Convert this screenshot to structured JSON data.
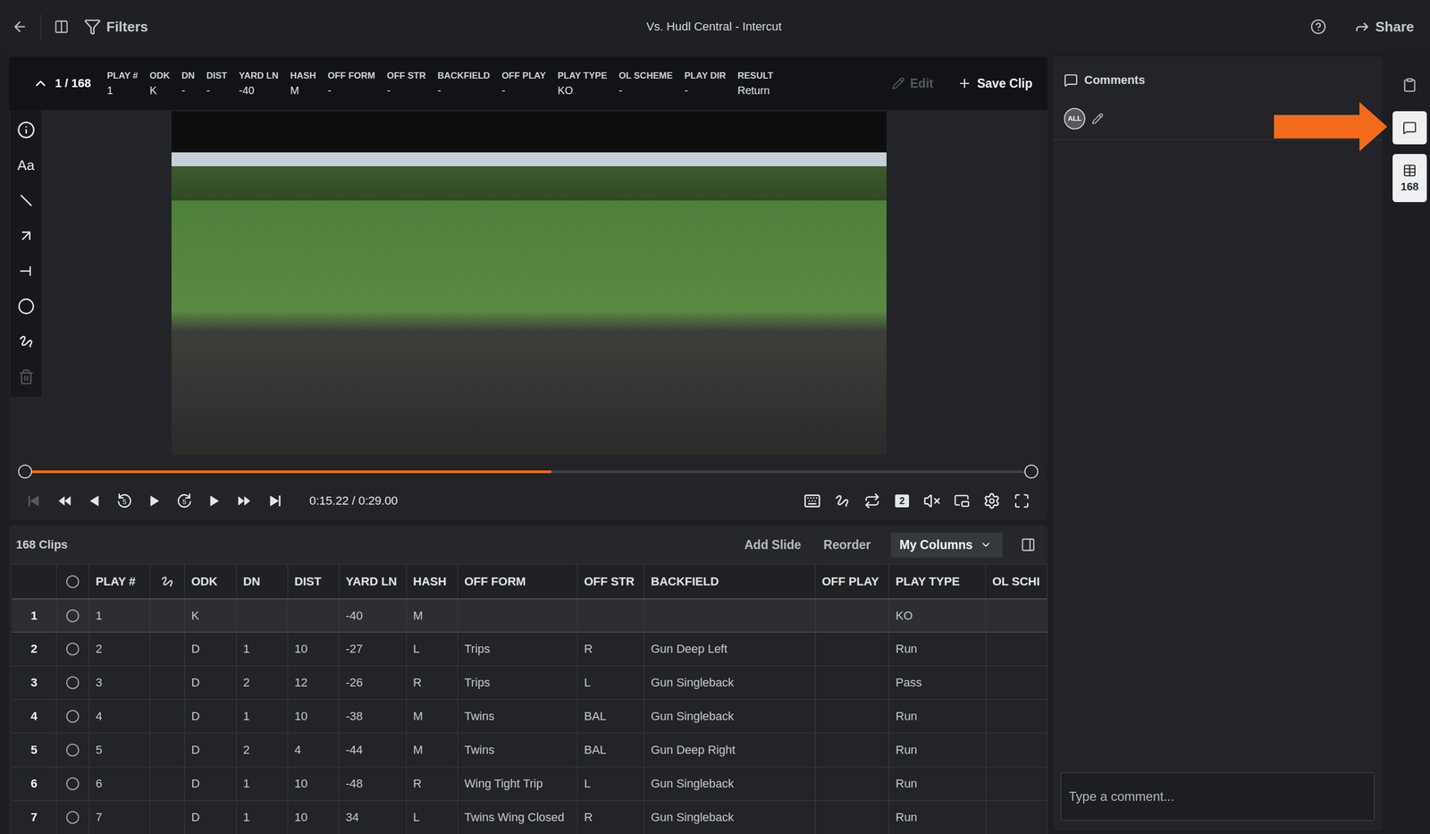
{
  "window": {
    "title": "Vs. Hudl Central - Intercut"
  },
  "topbar": {
    "filters": "Filters",
    "share": "Share"
  },
  "clip_header": {
    "position": "1 / 168",
    "fields": [
      {
        "label": "PLAY #",
        "value": "1"
      },
      {
        "label": "ODK",
        "value": "K"
      },
      {
        "label": "DN",
        "value": "-"
      },
      {
        "label": "DIST",
        "value": "-"
      },
      {
        "label": "YARD LN",
        "value": "-40"
      },
      {
        "label": "HASH",
        "value": "M"
      },
      {
        "label": "OFF FORM",
        "value": "-"
      },
      {
        "label": "OFF STR",
        "value": "-"
      },
      {
        "label": "BACKFIELD",
        "value": "-"
      },
      {
        "label": "OFF PLAY",
        "value": "-"
      },
      {
        "label": "PLAY TYPE",
        "value": "KO"
      },
      {
        "label": "OL SCHEME",
        "value": "-"
      },
      {
        "label": "PLAY DIR",
        "value": "-"
      },
      {
        "label": "RESULT",
        "value": "Return"
      }
    ],
    "edit": {
      "label": "Edit",
      "disabled": true
    },
    "save": "Save Clip"
  },
  "tools": [
    {
      "kind": "info",
      "disabled": false
    },
    {
      "kind": "text",
      "label": "Aa",
      "disabled": false
    },
    {
      "kind": "line",
      "disabled": false
    },
    {
      "kind": "arrow",
      "disabled": false
    },
    {
      "kind": "tee",
      "disabled": false
    },
    {
      "kind": "circle",
      "disabled": false
    },
    {
      "kind": "freehand",
      "disabled": false
    },
    {
      "kind": "delete",
      "disabled": true
    }
  ],
  "player": {
    "level": 0.523,
    "time": "0:15.22 / 0:29.00",
    "muted": true,
    "controls_left": [
      {
        "kind": "to-start",
        "disabled": true
      },
      {
        "kind": "fast-back",
        "disabled": false
      },
      {
        "kind": "step-back",
        "disabled": false
      },
      {
        "kind": "skip-back",
        "label": "5",
        "disabled": false
      },
      {
        "kind": "play",
        "disabled": false
      },
      {
        "kind": "skip-forward",
        "label": "5",
        "disabled": false
      },
      {
        "kind": "step-forward",
        "disabled": false
      },
      {
        "kind": "fast-forward",
        "disabled": false
      },
      {
        "kind": "to-end",
        "disabled": false
      }
    ],
    "controls_right": [
      {
        "kind": "keyboard"
      },
      {
        "kind": "drawings"
      },
      {
        "kind": "loop"
      },
      {
        "kind": "angle",
        "label": "2"
      },
      {
        "kind": "mute"
      },
      {
        "kind": "pip"
      },
      {
        "kind": "settings"
      },
      {
        "kind": "fullscreen"
      }
    ]
  },
  "clips": {
    "count": "168 Clips",
    "actions": [
      "Add Slide",
      "Reorder"
    ],
    "columns_menu": "My Columns",
    "columns": [
      {
        "kind": "text",
        "label": "PLAY #"
      },
      {
        "kind": "icon",
        "label": ""
      },
      {
        "kind": "text",
        "label": "ODK"
      },
      {
        "kind": "text",
        "label": "DN"
      },
      {
        "kind": "text",
        "label": "DIST"
      },
      {
        "kind": "text",
        "label": "YARD LN"
      },
      {
        "kind": "text",
        "label": "HASH"
      },
      {
        "kind": "text",
        "label": "OFF FORM"
      },
      {
        "kind": "text",
        "label": "OFF STR"
      },
      {
        "kind": "text",
        "label": "BACKFIELD"
      },
      {
        "kind": "text",
        "label": "OFF PLAY"
      },
      {
        "kind": "text",
        "label": "PLAY TYPE"
      },
      {
        "kind": "text",
        "label": "OL SCHI"
      }
    ],
    "rows": [
      {
        "index": "1",
        "selected": true,
        "checked": false,
        "cells": [
          "1",
          "",
          "K",
          "",
          "",
          "-40",
          "M",
          "",
          "",
          "",
          "",
          "KO",
          ""
        ]
      },
      {
        "index": "2",
        "selected": false,
        "checked": false,
        "cells": [
          "2",
          "",
          "D",
          "1",
          "10",
          "-27",
          "L",
          "Trips",
          "R",
          "Gun Deep Left",
          "",
          "Run",
          ""
        ]
      },
      {
        "index": "3",
        "selected": false,
        "checked": false,
        "cells": [
          "3",
          "",
          "D",
          "2",
          "12",
          "-26",
          "R",
          "Trips",
          "L",
          "Gun Singleback",
          "",
          "Pass",
          ""
        ]
      },
      {
        "index": "4",
        "selected": false,
        "checked": false,
        "cells": [
          "4",
          "",
          "D",
          "1",
          "10",
          "-38",
          "M",
          "Twins",
          "BAL",
          "Gun Singleback",
          "",
          "Run",
          ""
        ]
      },
      {
        "index": "5",
        "selected": false,
        "checked": false,
        "cells": [
          "5",
          "",
          "D",
          "2",
          "4",
          "-44",
          "M",
          "Twins",
          "BAL",
          "Gun Deep Right",
          "",
          "Run",
          ""
        ]
      },
      {
        "index": "6",
        "selected": false,
        "checked": false,
        "cells": [
          "6",
          "",
          "D",
          "1",
          "10",
          "-48",
          "R",
          "Wing Tight Trip",
          "L",
          "Gun Singleback",
          "",
          "Run",
          ""
        ]
      },
      {
        "index": "7",
        "selected": false,
        "checked": false,
        "cells": [
          "7",
          "",
          "D",
          "1",
          "10",
          "34",
          "L",
          "Twins Wing Closed",
          "R",
          "Gun Singleback",
          "",
          "Run",
          ""
        ]
      }
    ]
  },
  "comments": {
    "title": "Comments",
    "filter": "ALL",
    "placeholder": "Type a comment..."
  },
  "rail": [
    {
      "kind": "clipboard",
      "selected": false
    },
    {
      "kind": "comments",
      "selected": true
    },
    {
      "kind": "clips",
      "label": "168",
      "selected": true
    }
  ]
}
